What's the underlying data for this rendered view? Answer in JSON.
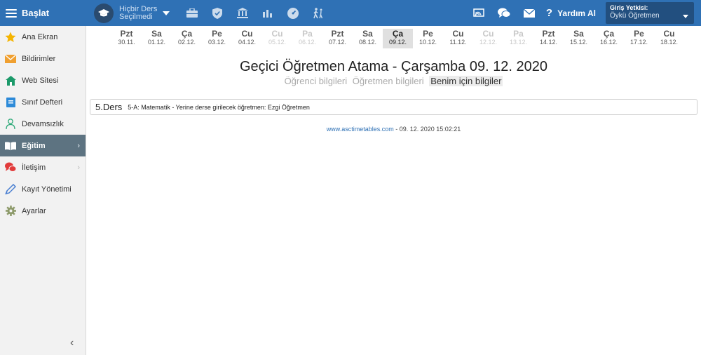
{
  "topbar": {
    "brand": "Başlat",
    "course_line1": "Hiçbir Ders",
    "course_line2": "Seçilmedi",
    "icons": [
      "briefcase-icon",
      "shield-icon",
      "building-icon",
      "bar-chart-icon",
      "dashboard-icon",
      "walking-icon"
    ],
    "right_icons": [
      "cast-icon",
      "chat-icon",
      "mail-icon"
    ],
    "help_label": "Yardım Al",
    "user_title": "Giriş Yetkisi:",
    "user_name": "Öykü Öğretmen",
    "accent": "#2f71b5"
  },
  "sidebar": {
    "items": [
      {
        "label": "Ana Ekran",
        "icon": "star-icon"
      },
      {
        "label": "Bildirimler",
        "icon": "envelope-icon"
      },
      {
        "label": "Web Sitesi",
        "icon": "home-icon"
      },
      {
        "label": "Sınıf Defteri",
        "icon": "notebook-icon"
      },
      {
        "label": "Devamsızlık",
        "icon": "person-icon"
      },
      {
        "label": "Eğitim",
        "icon": "book-icon",
        "active": true
      },
      {
        "label": "İletişim",
        "icon": "chat-bubbles-icon"
      },
      {
        "label": "Kayıt Yönetimi",
        "icon": "pencil-icon"
      },
      {
        "label": "Ayarlar",
        "icon": "gear-icon"
      }
    ],
    "collapse_label": "‹"
  },
  "days": [
    {
      "name": "Pzt",
      "date": "30.11."
    },
    {
      "name": "Sa",
      "date": "01.12."
    },
    {
      "name": "Ça",
      "date": "02.12."
    },
    {
      "name": "Pe",
      "date": "03.12."
    },
    {
      "name": "Cu",
      "date": "04.12."
    },
    {
      "name": "Cu",
      "date": "05.12.",
      "weekend": true
    },
    {
      "name": "Pa",
      "date": "06.12.",
      "weekend": true
    },
    {
      "name": "Pzt",
      "date": "07.12."
    },
    {
      "name": "Sa",
      "date": "08.12."
    },
    {
      "name": "Ça",
      "date": "09.12.",
      "selected": true
    },
    {
      "name": "Pe",
      "date": "10.12."
    },
    {
      "name": "Cu",
      "date": "11.12."
    },
    {
      "name": "Cu",
      "date": "12.12.",
      "weekend": true
    },
    {
      "name": "Pa",
      "date": "13.12.",
      "weekend": true
    },
    {
      "name": "Pzt",
      "date": "14.12."
    },
    {
      "name": "Sa",
      "date": "15.12."
    },
    {
      "name": "Ça",
      "date": "16.12."
    },
    {
      "name": "Pe",
      "date": "17.12."
    },
    {
      "name": "Cu",
      "date": "18.12."
    }
  ],
  "main": {
    "title": "Geçici Öğretmen Atama - Çarşamba 09. 12. 2020",
    "tabs": [
      "Öğrenci bilgileri",
      "Öğretmen bilgileri",
      "Benim için bilgiler"
    ],
    "lesson_number": "5.Ders",
    "lesson_text": "5-A: Matematik - Yerine derse girilecek öğretmen: Ezgi Öğretmen",
    "footer_link": "www.asctimetables.com",
    "footer_text": " - 09. 12. 2020 15:02:21"
  }
}
